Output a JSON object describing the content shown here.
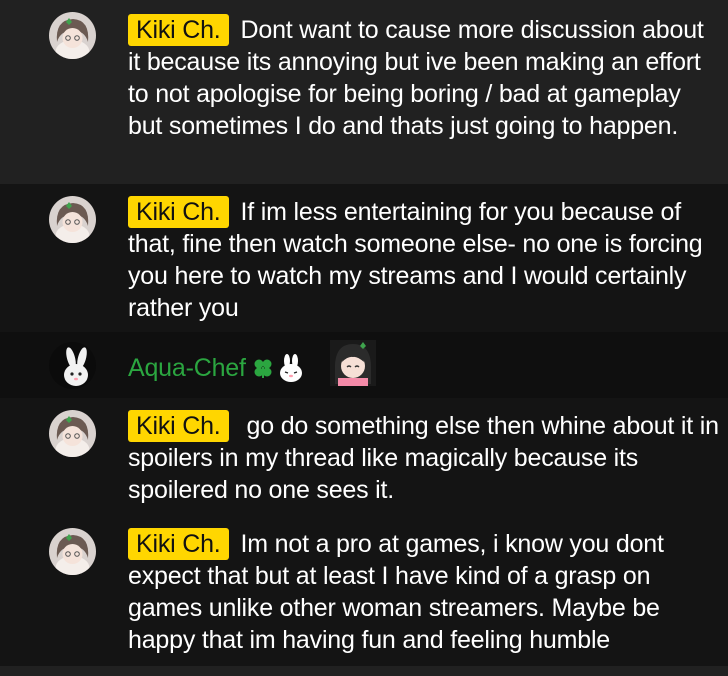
{
  "messages": [
    {
      "author": "Kiki Ch.",
      "text": "Dont want to cause more discussion about it because its annoying but ive been making an effort to not apologise for being boring / bad at gameplay but sometimes I do and thats just going to happen.",
      "author_badge_color": "#ffd600"
    },
    {
      "author": "Kiki Ch.",
      "text": "If im less entertaining for you because of that, fine then watch someone else- no one is forcing you here to watch my streams and I would certainly rather you"
    },
    {
      "author": "Aqua-Chef",
      "text": "",
      "author_color": "#2ba640",
      "emotes": [
        "clover-icon",
        "bunny-emote",
        "girl-sticker"
      ]
    },
    {
      "author": "Kiki Ch.",
      "text": "go do something else then whine about it in spoilers in my thread like magically because its spoilered no one sees it."
    },
    {
      "author": "Kiki Ch.",
      "text": "Im not a pro at games, i know you dont expect that but at least I have kind of a grasp on games unlike other woman streamers. Maybe be happy that im having fun and feeling humble"
    }
  ],
  "colors": {
    "background": "#212121",
    "highlight_row": "#141414",
    "badge": "#ffd600",
    "member_name": "#2ba640"
  }
}
